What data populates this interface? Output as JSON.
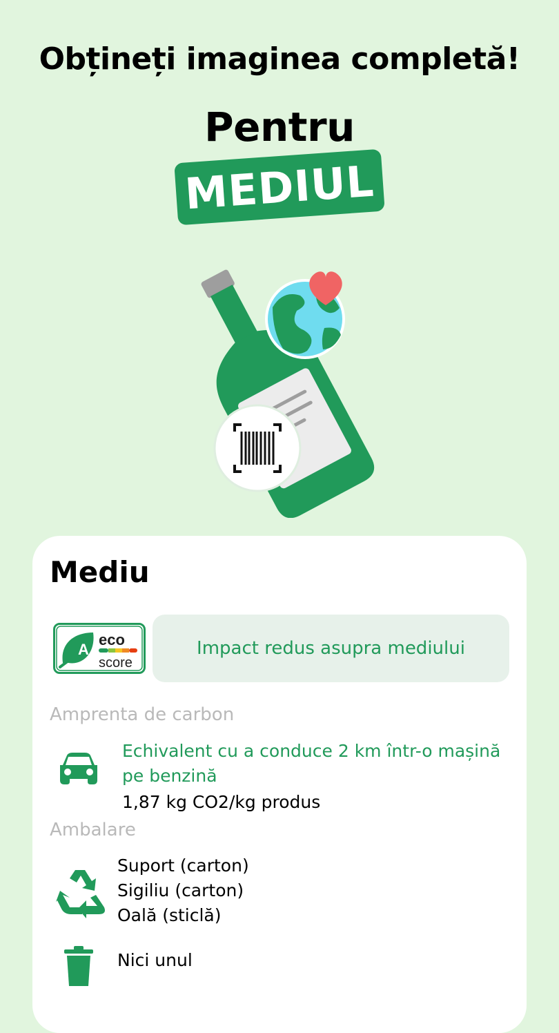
{
  "header": {
    "headline": "Obțineți imaginea completă!",
    "subhead": "Pentru",
    "badge": "MEDIUL"
  },
  "card": {
    "title": "Mediu",
    "ecoscore": {
      "grade": "A",
      "logo_top": "eco",
      "logo_bottom": "score",
      "description": "Impact redus asupra mediului"
    },
    "carbon": {
      "label": "Amprenta de carbon",
      "equivalent": "Echivalent cu a conduce 2 km într-o mașină pe benzină",
      "value": "1,87 kg CO2/kg produs"
    },
    "packaging": {
      "label": "Ambalare",
      "items": [
        "Suport (carton)",
        "Sigiliu (carton)",
        "Oală (sticlă)"
      ],
      "non_recyclable": "Nici unul"
    }
  },
  "colors": {
    "background": "#e1f5de",
    "accent_green": "#219a5a",
    "pill_bg": "#e7f1ea",
    "muted_label": "#b9b9b9"
  },
  "icons": [
    "bottle-illustration",
    "globe-icon",
    "heart-icon",
    "barcode-scan-icon",
    "car-icon",
    "recycle-icon",
    "trash-icon"
  ]
}
